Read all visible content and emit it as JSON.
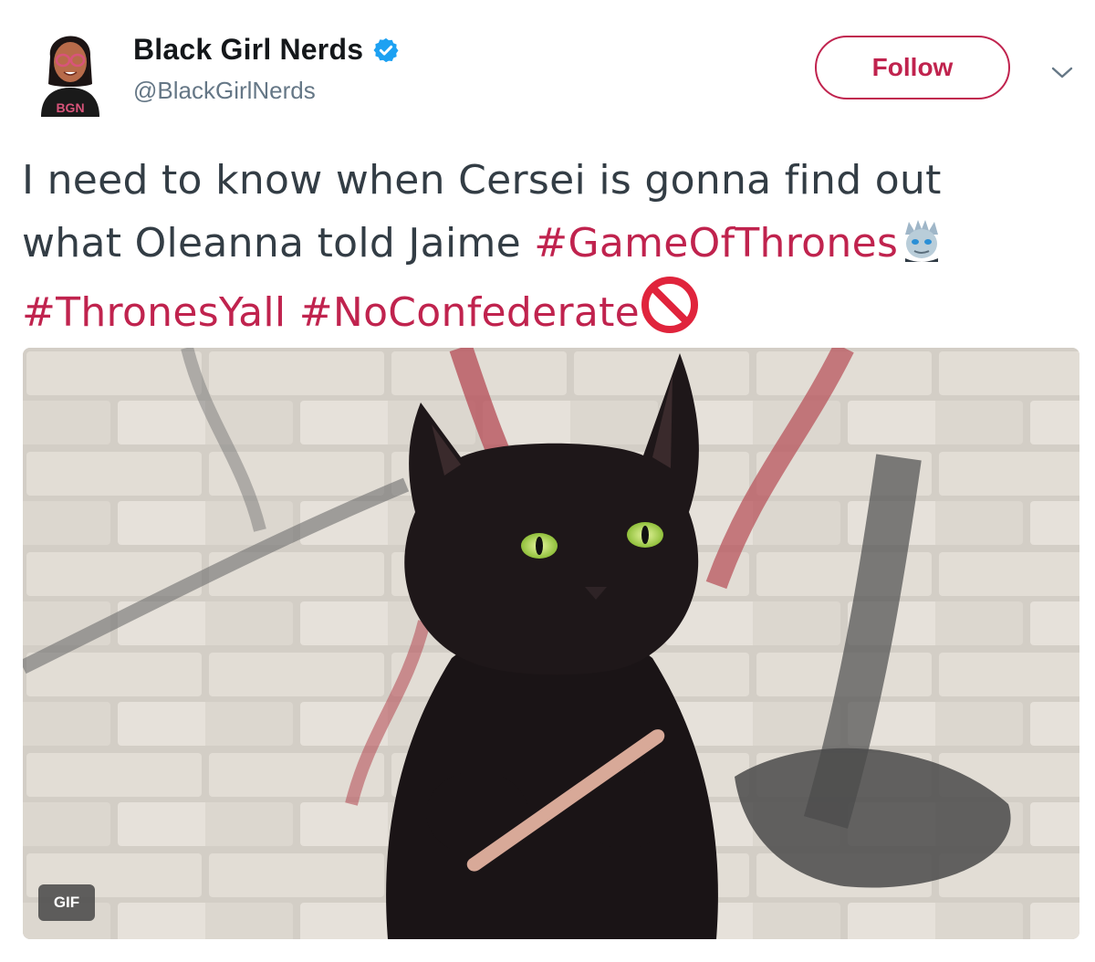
{
  "tweet": {
    "author": {
      "display_name": "Black Girl Nerds",
      "handle": "@BlackGirlNerds",
      "verified": true,
      "avatar_text": "BGN"
    },
    "follow_label": "Follow",
    "text_lines": [
      [
        {
          "type": "text",
          "value": "I need to know when Cersei is gonna find out"
        }
      ],
      [
        {
          "type": "text",
          "value": "what Oleanna told Jaime "
        },
        {
          "type": "hashtag",
          "value": "#GameOfThrones"
        },
        {
          "type": "emoji",
          "icon": "night-king-icon"
        }
      ],
      [
        {
          "type": "hashtag",
          "value": "#ThronesYall"
        },
        {
          "type": "text",
          "value": " "
        },
        {
          "type": "hashtag",
          "value": "#NoConfederate"
        },
        {
          "type": "emoji",
          "icon": "prohibited-icon"
        }
      ]
    ],
    "media": {
      "kind": "gif",
      "badge": "GIF",
      "description_icon": "cat-filing-nails-image"
    }
  },
  "colors": {
    "accent": "#c0234e",
    "verified": "#1da1f2",
    "text": "#333d45",
    "secondary": "#657786"
  }
}
